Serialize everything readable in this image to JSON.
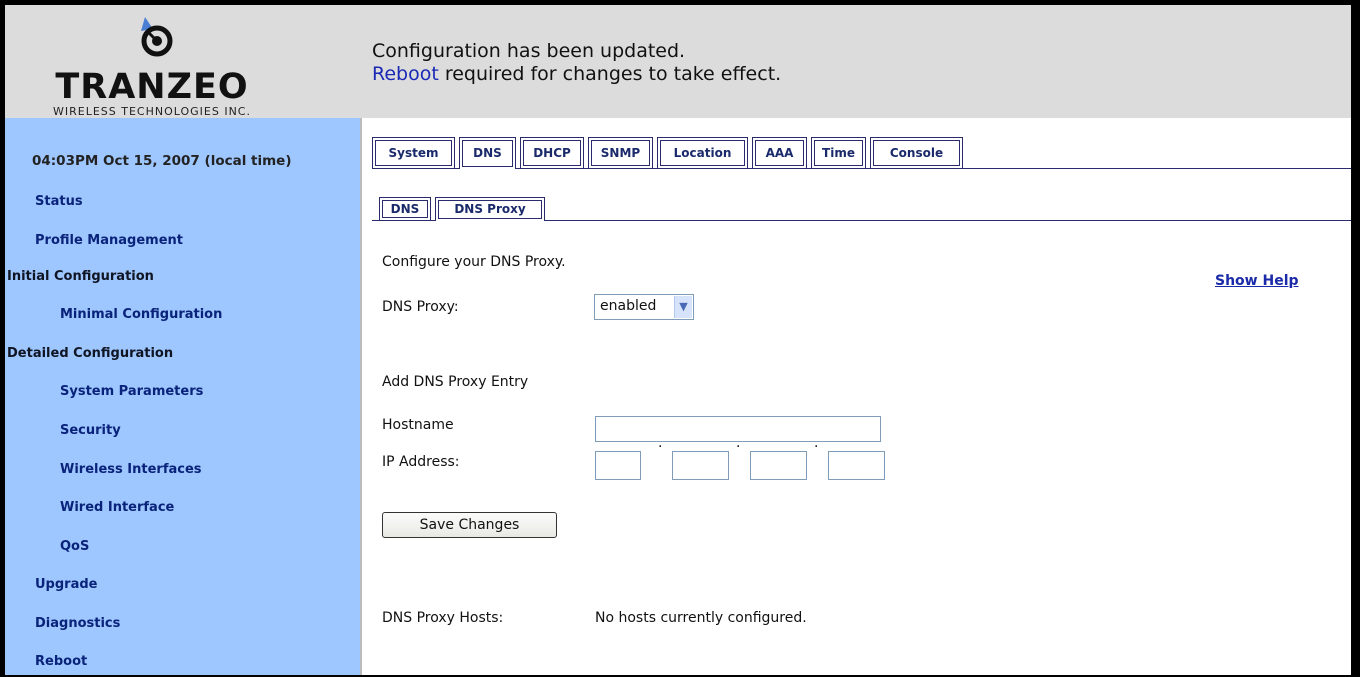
{
  "header": {
    "logo_text": "TRANZEO",
    "logo_subtext": "WIRELESS TECHNOLOGIES INC.",
    "notice_line1": "Configuration has been updated.",
    "notice_link": "Reboot",
    "notice_line2_rest": " required for changes to take effect."
  },
  "sidebar": {
    "time": "04:03PM Oct 15, 2007 (local time)",
    "status": "Status",
    "profile_management": "Profile Management",
    "initial_configuration": "Initial Configuration",
    "minimal_configuration": "Minimal Configuration",
    "detailed_configuration": "Detailed Configuration",
    "system_parameters": "System Parameters",
    "security": "Security",
    "wireless_interfaces": "Wireless Interfaces",
    "wired_interface": "Wired Interface",
    "qos": "QoS",
    "upgrade": "Upgrade",
    "diagnostics": "Diagnostics",
    "reboot": "Reboot"
  },
  "tabs": {
    "system": "System",
    "dns": "DNS",
    "dhcp": "DHCP",
    "snmp": "SNMP",
    "location": "Location",
    "aaa": "AAA",
    "time": "Time",
    "console": "Console",
    "active": "DNS"
  },
  "subtabs": {
    "dns": "DNS",
    "dns_proxy": "DNS Proxy",
    "active": "DNS Proxy"
  },
  "form": {
    "intro": "Configure your DNS Proxy.",
    "show_help": "Show Help",
    "dns_proxy_label": "DNS Proxy:",
    "dns_proxy_value": "enabled",
    "add_entry_heading": "Add DNS Proxy Entry",
    "hostname_label": "Hostname",
    "hostname_value": "",
    "ip_label": "IP Address:",
    "ip_octets": [
      "",
      "",
      "",
      ""
    ],
    "save_button": "Save Changes",
    "hosts_label": "DNS Proxy Hosts:",
    "hosts_value": "No hosts currently configured."
  },
  "colors": {
    "sidebar_bg": "#9ec6ff",
    "header_bg": "#dcdcdc",
    "link": "#1a29b5",
    "tab_text": "#1a2a6b"
  },
  "icons": {
    "logo_mark": "tranzeo-antenna-logo",
    "select_arrow": "chevron-down-icon"
  }
}
